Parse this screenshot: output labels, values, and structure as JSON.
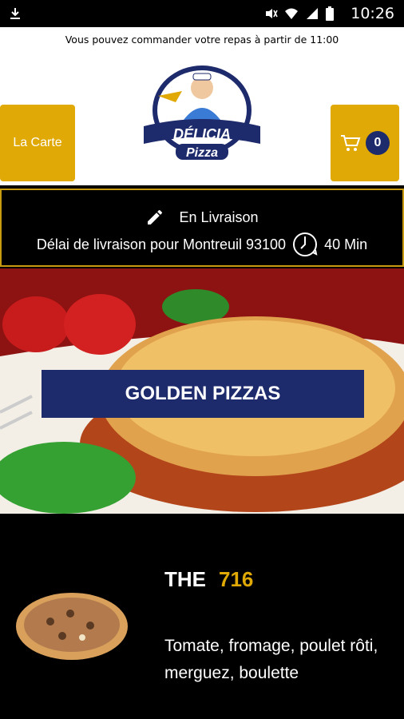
{
  "status_bar": {
    "time": "10:26"
  },
  "header": {
    "notice": "Vous pouvez commander votre repas à partir de 11:00",
    "menu_button": "La Carte",
    "cart_count": "0",
    "logo": {
      "name": "DÉLICIA",
      "sub": "Pizza"
    }
  },
  "delivery": {
    "mode": "En Livraison",
    "delay_text": "Délai de livraison pour Montreuil 93100",
    "delay_value": "40 Min"
  },
  "hero": {
    "banner": "GOLDEN PIZZAS"
  },
  "product": {
    "title_prefix": "THE",
    "title_number": "716",
    "description": "Tomate, fromage, poulet rôti, merguez, boulette"
  },
  "colors": {
    "gold": "#e0a906",
    "navy": "#1d2a6b"
  }
}
